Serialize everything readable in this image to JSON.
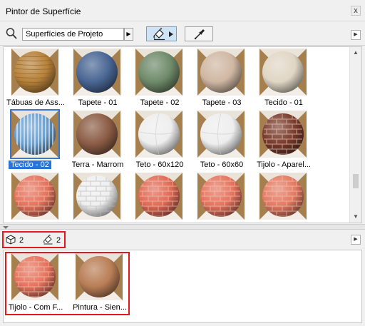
{
  "window": {
    "title": "Pintor de Superfície",
    "close_label": "x"
  },
  "toolbar": {
    "search_value": "Superfícies de Projeto",
    "search_go": "▶",
    "more_arrow": "▶",
    "paint_icon": "paint-bucket-icon",
    "eyedropper_icon": "eyedropper-icon"
  },
  "scrollbar": {
    "up": "▲",
    "down": "▼"
  },
  "materials": [
    {
      "label": "Tábuas de Ass...",
      "material": "wood",
      "color": "#b8823a"
    },
    {
      "label": "Tapete - 01",
      "material": "carpet-blue",
      "color": "#4a6694"
    },
    {
      "label": "Tapete - 02",
      "material": "carpet-green",
      "color": "#6f8a6a"
    },
    {
      "label": "Tapete - 03",
      "material": "carpet-tan",
      "color": "#d0b7a3"
    },
    {
      "label": "Tecido - 01",
      "material": "fabric-beige",
      "color": "#e0d6c5"
    },
    {
      "label": "Tecido - 02",
      "material": "fabric-stripe",
      "color": "#6aa0d0",
      "selected": true
    },
    {
      "label": "Terra - Marrom",
      "material": "soil",
      "color": "#8c5d46"
    },
    {
      "label": "Teto - 60x120",
      "material": "ceiling",
      "color": "#eeeeee"
    },
    {
      "label": "Teto - 60x60",
      "material": "ceiling",
      "color": "#eeeeee"
    },
    {
      "label": "Tijolo - Aparel...",
      "material": "brick-dark",
      "color": "#7b3b2c"
    },
    {
      "label": "",
      "material": "brick-red",
      "color": "#e5735d"
    },
    {
      "label": "",
      "material": "brick-white",
      "color": "#efefef"
    },
    {
      "label": "",
      "material": "brick-red",
      "color": "#e06a55"
    },
    {
      "label": "",
      "material": "brick-red",
      "color": "#e5735d"
    },
    {
      "label": "",
      "material": "brick-red",
      "color": "#e47a62"
    }
  ],
  "counts": {
    "elements": "2",
    "surfaces": "2",
    "element_icon": "cube-icon",
    "surface_icon": "paint-bucket-icon",
    "more_arrow": "▶"
  },
  "used_materials": [
    {
      "label": "Tijolo - Com F...",
      "material": "brick-red",
      "color": "#e5735d"
    },
    {
      "label": "Pintura - Sien...",
      "material": "paint",
      "color": "#b97e56"
    }
  ]
}
